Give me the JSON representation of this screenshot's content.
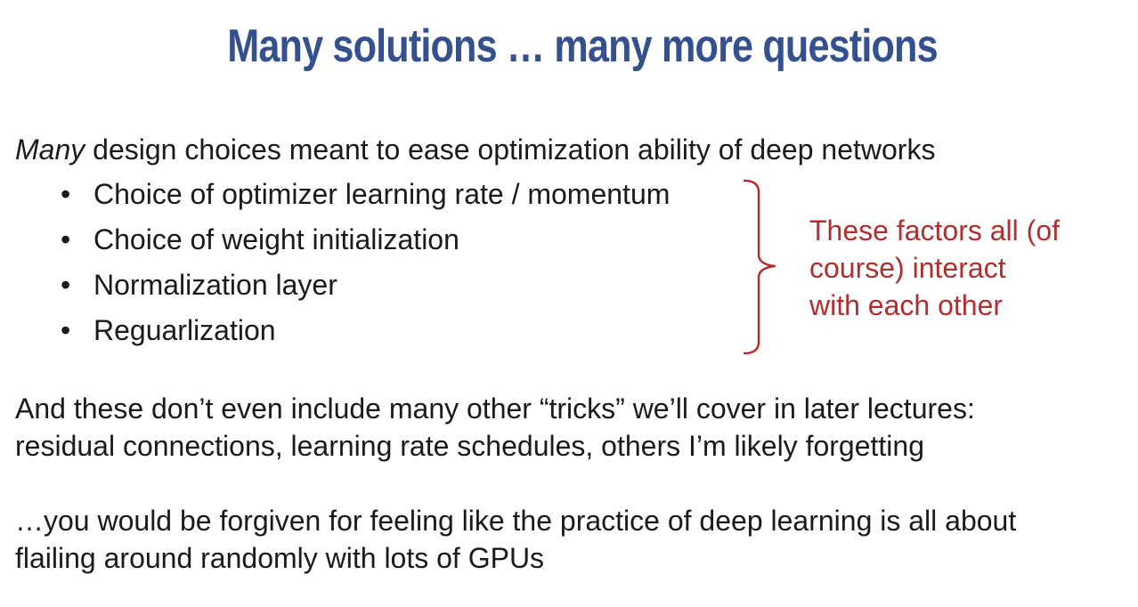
{
  "slide": {
    "title": "Many solutions … many more questions",
    "title_color": "#34508f",
    "accent_color": "#b02e2e"
  },
  "intro": {
    "emphasis": "Many",
    "rest": " design choices meant to ease optimization ability of deep networks"
  },
  "bullets": [
    "Choice of optimizer learning rate / momentum",
    "Choice of weight initialization",
    "Normalization layer",
    "Reguarlization"
  ],
  "annotation": {
    "line1": "These factors all (of",
    "line2": "course) interact",
    "line3": "with each other"
  },
  "paragraph1": {
    "line1": "And these don’t even include many other “tricks” we’ll cover in later lectures:",
    "line2": "residual connections, learning rate schedules, others I’m likely forgetting"
  },
  "paragraph2": {
    "line1": "…you would be forgiven for feeling like the practice of deep learning is all about",
    "line2": "flailing around randomly with lots of GPUs"
  }
}
